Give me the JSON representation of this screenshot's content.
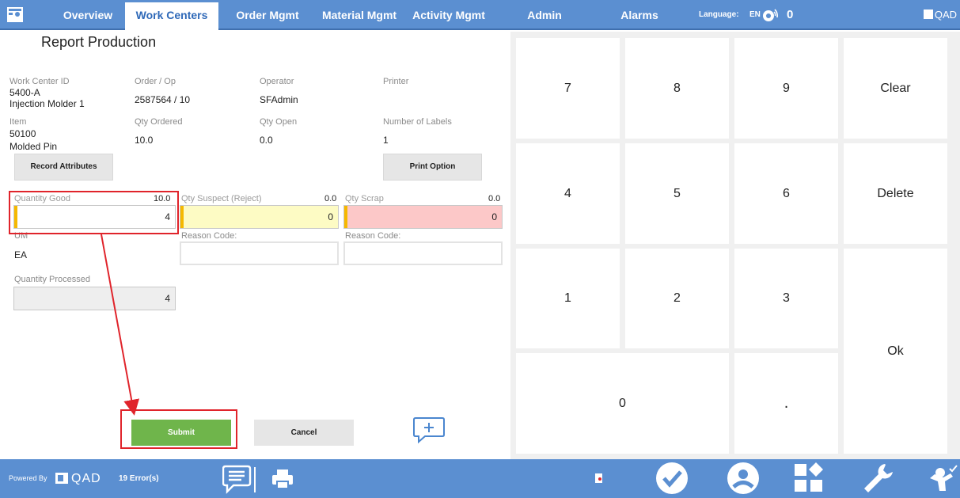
{
  "nav": {
    "tabs": [
      {
        "label": "Overview"
      },
      {
        "label": "Work Centers"
      },
      {
        "label": "Order Mgmt"
      },
      {
        "label": "Material Mgmt"
      },
      {
        "label": "Activity Mgmt"
      },
      {
        "label": "Admin"
      },
      {
        "label": "Alarms"
      }
    ],
    "language_label": "Language:",
    "language_value": "EN",
    "alarm_count": "0",
    "brand": "QAD"
  },
  "page": {
    "title": "Report Production"
  },
  "info": {
    "work_center_id_label": "Work Center ID",
    "work_center_id": "5400-A",
    "work_center_name": "Injection Molder 1",
    "order_op_label": "Order / Op",
    "order_op": "2587564 / 10",
    "operator_label": "Operator",
    "operator": "SFAdmin",
    "printer_label": "Printer",
    "item_label": "Item",
    "item": "50100",
    "item_desc": "Molded Pin",
    "qty_ordered_label": "Qty Ordered",
    "qty_ordered": "10.0",
    "qty_open_label": "Qty Open",
    "qty_open": "0.0",
    "num_labels_label": "Number of Labels",
    "num_labels": "1"
  },
  "buttons": {
    "record_attributes": "Record Attributes",
    "print_option": "Print Option",
    "submit": "Submit",
    "cancel": "Cancel"
  },
  "quantities": {
    "good_label": "Quantity Good",
    "good_default": "10.0",
    "good_value": "4",
    "suspect_label": "Qty Suspect (Reject)",
    "suspect_default": "0.0",
    "suspect_value": "0",
    "scrap_label": "Qty Scrap",
    "scrap_default": "0.0",
    "scrap_value": "0",
    "reason_label_1": "Reason Code:",
    "reason_label_2": "Reason Code:",
    "um_label": "UM",
    "um_value": "EA",
    "processed_label": "Quantity Processed",
    "processed_value": "4"
  },
  "keypad": {
    "k7": "7",
    "k8": "8",
    "k9": "9",
    "clear": "Clear",
    "k4": "4",
    "k5": "5",
    "k6": "6",
    "delete": "Delete",
    "k1": "1",
    "k2": "2",
    "k3": "3",
    "ok": "Ok",
    "k0": "0",
    "dot": "."
  },
  "footer": {
    "powered_by": "Powered By",
    "brand": "QAD",
    "errors": "19 Error(s)"
  },
  "colors": {
    "nav_bg": "#5b8fd1",
    "active_tab_text": "#2f69b8",
    "submit_bg": "#6fb54b",
    "suspect_bg": "#fdfbc4",
    "scrap_bg": "#fcc8c8",
    "highlight": "#e0242b",
    "required_bar": "#f5b800"
  }
}
